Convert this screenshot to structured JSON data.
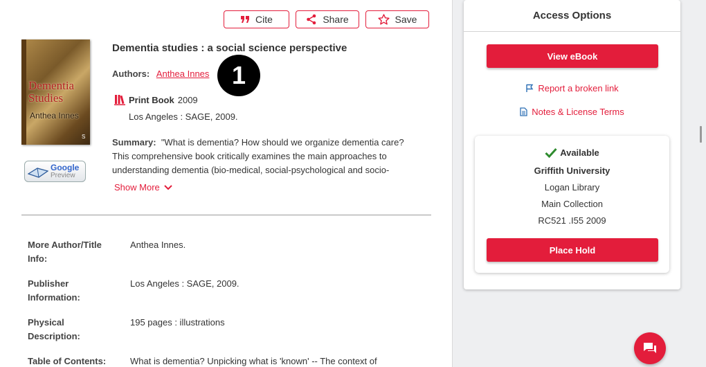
{
  "toolbar": {
    "cite_label": "Cite",
    "share_label": "Share",
    "save_label": "Save"
  },
  "record": {
    "cover": {
      "title_line1": "Dementia",
      "title_line2": "Studies",
      "author": "Anthea Innes",
      "publisher_mark": "S"
    },
    "google_preview": {
      "line1": "Google",
      "line2": "Preview"
    },
    "title": "Dementia studies : a social science perspective",
    "authors_label": "Authors:",
    "author_name": "Anthea Innes",
    "annotation_badge": "1",
    "format_label": "Print Book",
    "year": "2009",
    "publication": "Los Angeles : SAGE, 2009.",
    "summary_label": "Summary:",
    "summary_line1": "\"What is dementia? How should we organize dementia care?",
    "summary_line2": "This comprehensive book critically examines the main approaches to",
    "summary_line3": "understanding dementia (bio-medical, social-psychological and socio-",
    "show_more_label": "Show More"
  },
  "details": [
    {
      "label_line1": "More Author/Title",
      "label_line2": "Info:",
      "value": "Anthea Innes."
    },
    {
      "label_line1": "Publisher",
      "label_line2": "Information:",
      "value": "Los Angeles : SAGE, 2009."
    },
    {
      "label_line1": "Physical",
      "label_line2": "Description:",
      "value": "195 pages : illustrations"
    },
    {
      "label_line1": "Table of Contents:",
      "label_line2": "",
      "value": "What is dementia? Unpicking what is 'known' -- The context of"
    }
  ],
  "access": {
    "title": "Access Options",
    "view_ebook_label": "View eBook",
    "report_link_label": "Report a broken link",
    "notes_label": "Notes & License Terms",
    "availability": {
      "status": "Available",
      "institution": "Griffith University",
      "library": "Logan Library",
      "collection": "Main Collection",
      "call_number": "RC521 .I55 2009",
      "place_hold_label": "Place Hold"
    }
  },
  "colors": {
    "accent": "#e31d3b",
    "available_check": "#2e8b2e"
  }
}
